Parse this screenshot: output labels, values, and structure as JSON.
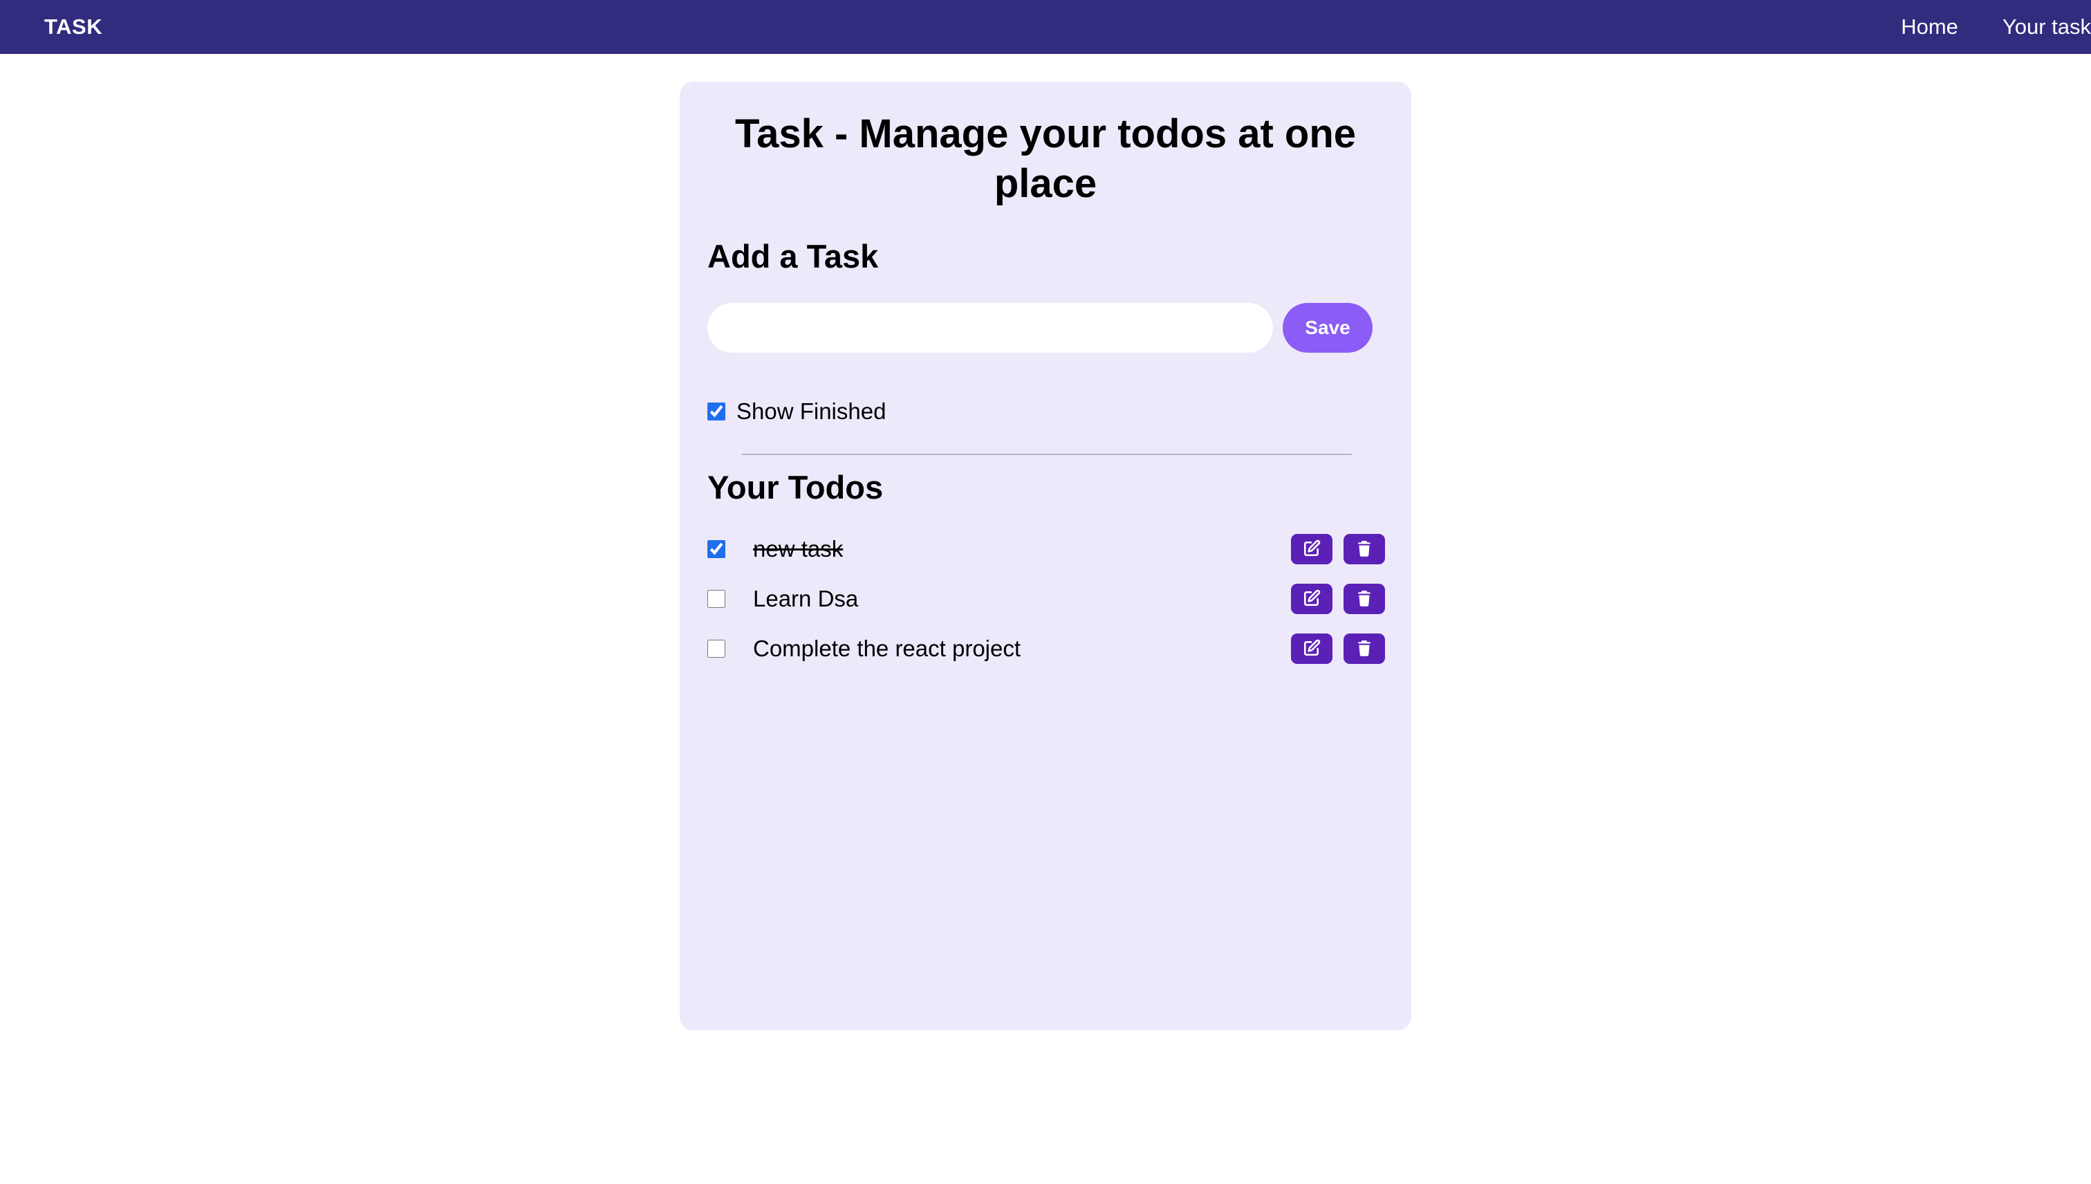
{
  "navbar": {
    "brand": "TASK",
    "links": [
      "Home",
      "Your task"
    ]
  },
  "main": {
    "title": "Task - Manage your todos at one place",
    "add_heading": "Add a Task",
    "input": {
      "value": "",
      "placeholder": ""
    },
    "save_label": "Save",
    "show_finished": {
      "label": "Show Finished",
      "checked": true
    },
    "todos_heading": "Your Todos",
    "todos": [
      {
        "text": "new task",
        "completed": true
      },
      {
        "text": "Learn Dsa",
        "completed": false
      },
      {
        "text": "Complete the react project",
        "completed": false
      }
    ]
  },
  "colors": {
    "navbar_bg": "#312c7e",
    "card_bg": "#ede9fb",
    "save_button": "#8b5cf6",
    "icon_button": "#5b21b6"
  },
  "icons": {
    "edit": "edit-icon",
    "delete": "trash-icon"
  }
}
